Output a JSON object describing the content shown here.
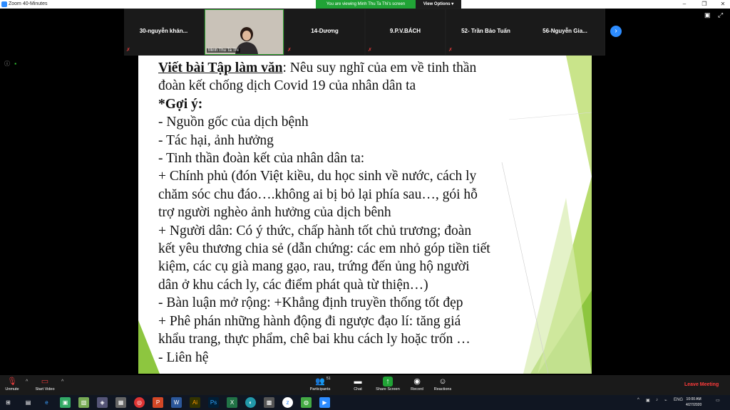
{
  "window": {
    "title": "Zoom 40-Minutes"
  },
  "banner": {
    "viewing": "You are viewing Minh Thu Ta Thi's screen",
    "view_options": "View Options ▾"
  },
  "participants": [
    {
      "name": "30-nguyễn khán..."
    },
    {
      "name": "Minh Thu Ta Thi"
    },
    {
      "name": "14-Dương"
    },
    {
      "name": "9.P.V.BÁCH"
    },
    {
      "name": "52- Trần Bảo Tuấn"
    },
    {
      "name": "56-Nguyễn Gia..."
    }
  ],
  "slide": {
    "heading": "Viết bài Tập làm văn",
    "heading_rest": ": Nêu suy nghĩ của em về tinh thần",
    "lines": [
      "đoàn kết chống dịch Covid 19 của nhân dân ta",
      "*Gợi ý:",
      "-   Nguồn gốc của dịch bệnh",
      "-   Tác hại, ảnh hưởng",
      "-   Tinh thần đoàn kết của nhân dân ta:",
      "+ Chính phủ (đón Việt kiều, du học sinh về nước, cách ly",
      "chăm sóc chu đáo….không ai bị bỏ lại phía sau…, gói hỗ",
      "trợ người nghèo ảnh hưởng của dịch bênh",
      "+ Người dân: Có ý thức, chấp hành tốt chủ trương; đoàn",
      "kết yêu thương chia sẻ (dẫn chứng: các em nhỏ góp tiền tiết",
      "kiệm, các cụ già mang gạo, rau, trứng đến ủng hộ người",
      "dân ở khu cách ly, các điểm phát quà từ thiện…)",
      "-   Bàn luận mở rộng: +Khẳng định truyền thống tốt đẹp",
      "+ Phê phán những hành động đi ngược đạo lí: tăng giá",
      "khẩu trang, thực phẩm, chê bai khu cách ly hoặc trốn …",
      "- Liên hệ"
    ]
  },
  "toolbar": {
    "unmute": "Unmute",
    "start_video": "Start Video",
    "participants": "Participants",
    "participants_count": "51",
    "chat": "Chat",
    "share_screen": "Share Screen",
    "record": "Record",
    "reactions": "Reactions",
    "leave": "Leave Meeting"
  },
  "taskbar": {
    "lang": "ENG",
    "time": "10:00 AM",
    "date": "4/27/2020"
  },
  "colors": {
    "accent": "#2d8cff",
    "banner_green": "#21a336",
    "slide_green": "#8dc63f",
    "leave_red": "#ff3b3b"
  }
}
